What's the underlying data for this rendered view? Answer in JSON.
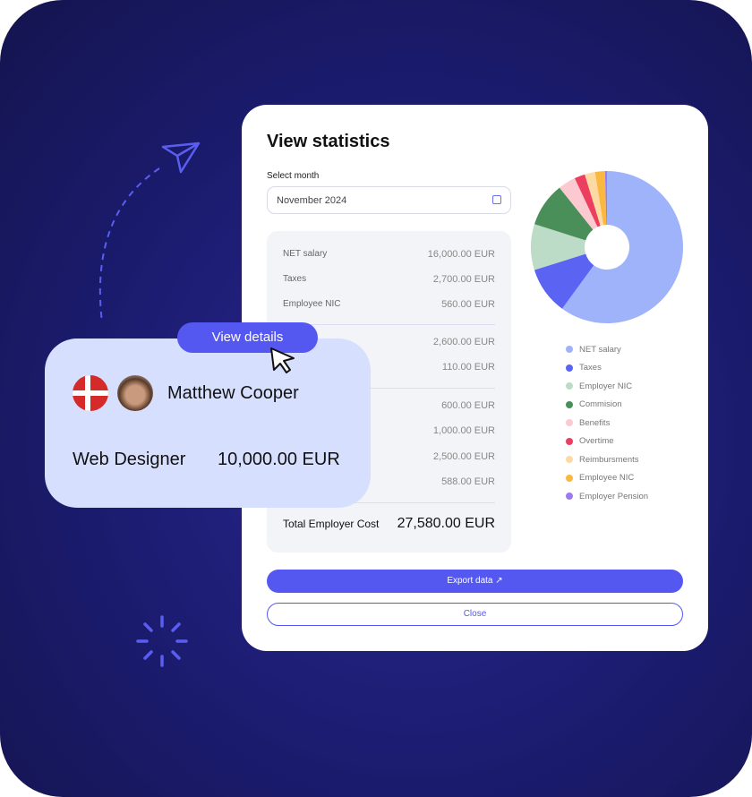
{
  "title": "View statistics",
  "select": {
    "label": "Select month",
    "value": "November 2024"
  },
  "rows": [
    {
      "label": "NET salary",
      "value": "16,000.00 EUR"
    },
    {
      "label": "Taxes",
      "value": "2,700.00 EUR"
    },
    {
      "label": "Employee NIC",
      "value": "560.00 EUR"
    },
    {
      "label": "",
      "value": "2,600.00 EUR"
    },
    {
      "label": "",
      "value": "110.00 EUR"
    },
    {
      "label": "",
      "value": "600.00 EUR"
    },
    {
      "label": "",
      "value": "1,000.00 EUR"
    },
    {
      "label": "",
      "value": "2,500.00 EUR"
    },
    {
      "label": "",
      "value": "588.00 EUR"
    }
  ],
  "total": {
    "label": "Total Employer Cost",
    "value": "27,580.00 EUR"
  },
  "buttons": {
    "export": "Export data",
    "close": "Close",
    "view_details": "View details"
  },
  "user": {
    "name": "Matthew Cooper",
    "role": "Web Designer",
    "salary": "10,000.00 EUR"
  },
  "chart_data": {
    "type": "pie",
    "donut": true,
    "categories": [
      "NET salary",
      "Taxes",
      "Employer NIC",
      "Commision",
      "Benefits",
      "Overtime",
      "Reimbursments",
      "Employee NIC",
      "Employer Pension"
    ],
    "values": [
      16000,
      2700,
      2600,
      2500,
      1000,
      600,
      588,
      560,
      110
    ],
    "colors": [
      "#9fb3fb",
      "#5b63f2",
      "#bcdcc8",
      "#4a8f5a",
      "#fcc9d0",
      "#ec3e5f",
      "#fdd9a3",
      "#fbb83e",
      "#9a7cef"
    ],
    "legend": "bottom"
  }
}
